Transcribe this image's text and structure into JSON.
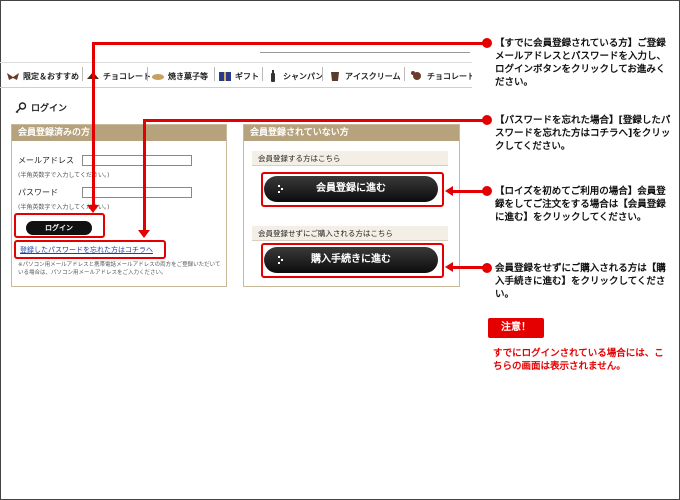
{
  "nav": {
    "items": [
      {
        "label": "限定＆おすすめ",
        "icon": "gift-ribbon-icon"
      },
      {
        "label": "チョコレート",
        "icon": "chocolate-icon"
      },
      {
        "label": "焼き菓子等",
        "icon": "baked-sweets-icon"
      },
      {
        "label": "ギフト",
        "icon": "gift-box-icon"
      },
      {
        "label": "シャンパン",
        "icon": "champagne-icon"
      },
      {
        "label": "アイスクリーム",
        "icon": "ice-cream-icon"
      },
      {
        "label": "チョコレートワー",
        "icon": "chocolate-world-icon"
      }
    ]
  },
  "login_header": {
    "title": "ログイン",
    "icon": "key-icon"
  },
  "member_panel": {
    "title": "会員登録済みの方",
    "email_label": "メールアドレス",
    "email_hint": "(半角英数字で入力してください。)",
    "password_label": "パスワード",
    "password_hint": "(半角英数字で入力してください。)",
    "login_button": "ログイン",
    "forgot_link": "登録したパスワードを忘れた方はコチラへ",
    "note": "※パソコン用メールアドレスと携帯電話メールアドレスの両方をご登録いただいている場合は、パソコン用メールアドレスをご入力ください。"
  },
  "guest_panel": {
    "title": "会員登録されていない方",
    "register_heading": "会員登録する方はこちら",
    "register_button": "会員登録に進む",
    "guest_heading": "会員登録せずにご購入される方はこちら",
    "guest_button": "購入手続きに進む"
  },
  "callouts": {
    "c1": "【すでに会員登録されている方】ご登録メールアドレスとパスワードを入力し、ログインボタンをクリックしてお進みください。",
    "c2": "【パスワードを忘れた場合】[登録したパスワードを忘れた方はコチラへ]をクリックしてください。",
    "c3": "【ロイズを初めてご利用の場合】会員登録をしてご注文をする場合は【会員登録に進む】をクリックしてください。",
    "c4": "会員登録をせずにご購入される方は【購入手続きに進む】をクリックしてください。"
  },
  "warning": {
    "badge": "注意！",
    "text": "すでにログインされている場合には、こちらの画面は表示されません。"
  },
  "colors": {
    "accent_red": "#e40000",
    "panel_title": "#b6a37e",
    "link_blue": "#1a3fa6"
  }
}
